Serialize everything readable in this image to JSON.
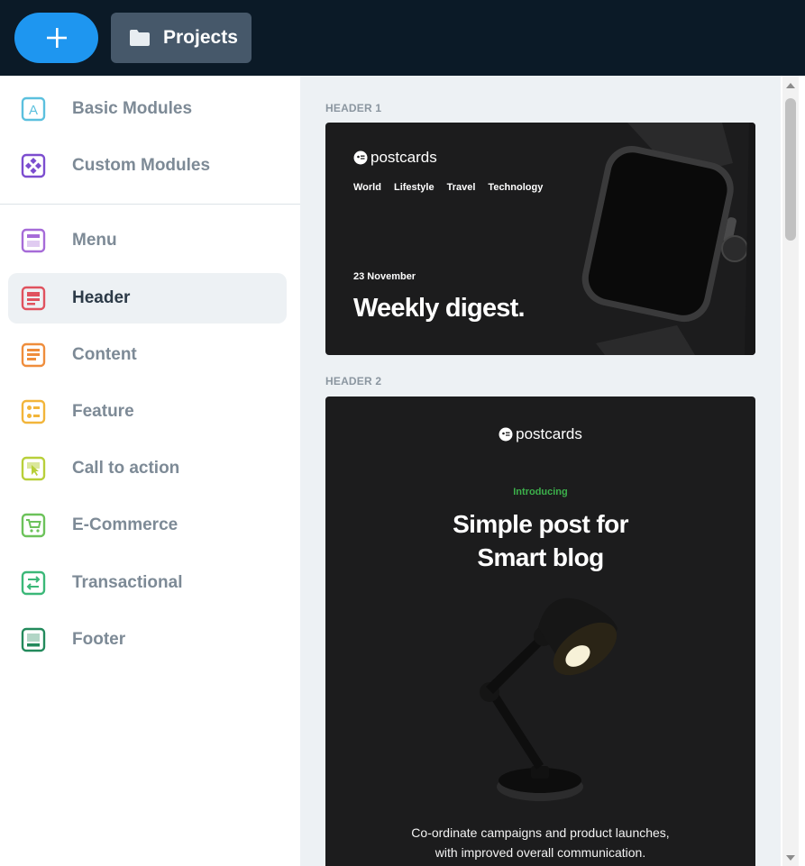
{
  "toolbar": {
    "add_icon": "plus-icon",
    "projects_label": "Projects",
    "projects_icon": "folder-icon"
  },
  "sidebar": {
    "items": [
      {
        "label": "Basic Modules",
        "icon": "letter-a-icon",
        "color": "#5bc0de"
      },
      {
        "label": "Custom Modules",
        "icon": "diamond-grid-icon",
        "color": "#7c4dcf"
      },
      {
        "label": "Menu",
        "icon": "menu-module-icon",
        "color": "#a66bd8"
      },
      {
        "label": "Header",
        "icon": "header-module-icon",
        "color": "#e0525e",
        "active": true
      },
      {
        "label": "Content",
        "icon": "content-module-icon",
        "color": "#ef8d3c"
      },
      {
        "label": "Feature",
        "icon": "feature-module-icon",
        "color": "#f2b53a"
      },
      {
        "label": "Call to action",
        "icon": "cursor-click-icon",
        "color": "#b8cf3a"
      },
      {
        "label": "E-Commerce",
        "icon": "cart-icon",
        "color": "#6cc25a"
      },
      {
        "label": "Transactional",
        "icon": "transfer-icon",
        "color": "#3bb878"
      },
      {
        "label": "Footer",
        "icon": "footer-module-icon",
        "color": "#238a5c"
      }
    ]
  },
  "main": {
    "header1": {
      "section_label": "HEADER 1",
      "brand": "postcards",
      "nav": [
        "World",
        "Lifestyle",
        "Travel",
        "Technology"
      ],
      "date": "23 November",
      "title": "Weekly digest."
    },
    "header2": {
      "section_label": "HEADER 2",
      "brand": "postcards",
      "eyebrow": "Introducing",
      "title_line1": "Simple post for",
      "title_line2": "Smart blog",
      "body_line1": "Co-ordinate campaigns and product launches,",
      "body_line2": "with improved overall communication."
    }
  },
  "colors": {
    "topbar": "#0b1a27",
    "accent": "#1e96f0",
    "eyebrow_green": "#3cb04b"
  }
}
